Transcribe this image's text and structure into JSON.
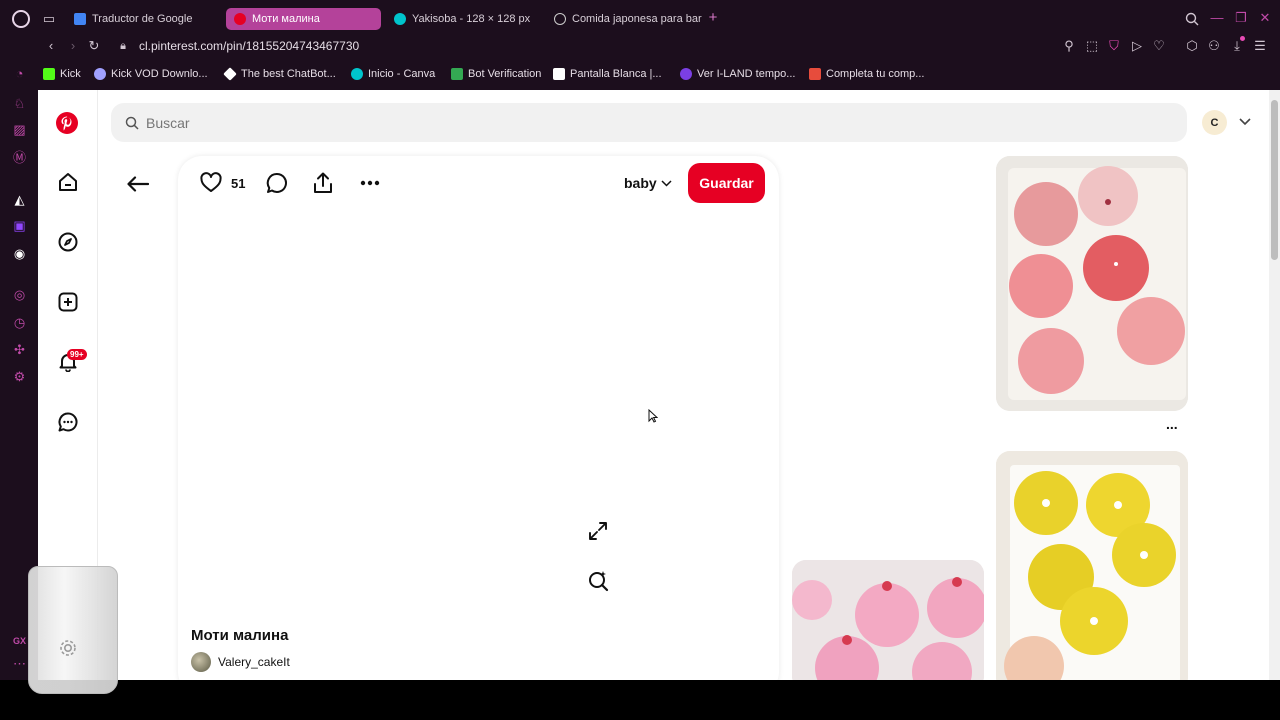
{
  "browser": {
    "tabs": [
      {
        "label": "Traductor de Google",
        "active": false
      },
      {
        "label": "Моти малина",
        "active": true
      },
      {
        "label": "Yakisoba - 128 × 128 px",
        "active": false
      },
      {
        "label": "Comida japonesa para bar",
        "active": false
      }
    ],
    "new_tab": "+",
    "url": "cl.pinterest.com/pin/18155204743467730",
    "bookmarks": [
      {
        "label": "Kick",
        "color": "#53fc18"
      },
      {
        "label": "Kick VOD Downlo...",
        "color": "#a0a0ff"
      },
      {
        "label": "The best ChatBot...",
        "color": "#ffffff"
      },
      {
        "label": "Inicio - Canva",
        "color": "#00c4cc"
      },
      {
        "label": "Bot Verification",
        "color": "#34a853"
      },
      {
        "label": "Pantalla Blanca |...",
        "color": "#ffffff"
      },
      {
        "label": "Ver I-LAND tempo...",
        "color": "#7b3fe4"
      },
      {
        "label": "Completa tu comp...",
        "color": "#e74c3c"
      }
    ],
    "sidebar_bottom_label": "GX"
  },
  "pinterest": {
    "search_placeholder": "Buscar",
    "avatar_letter": "C",
    "notification_badge": "99+",
    "likes_count": "51",
    "board_name": "baby",
    "save_label": "Guardar",
    "pin_title": "Моти малина",
    "author": "Valery_cakeIt",
    "more_dots": "..."
  },
  "colors": {
    "brand_red": "#e60023",
    "chrome_bg": "#1c0e1d",
    "active_tab": "#b4429a"
  }
}
